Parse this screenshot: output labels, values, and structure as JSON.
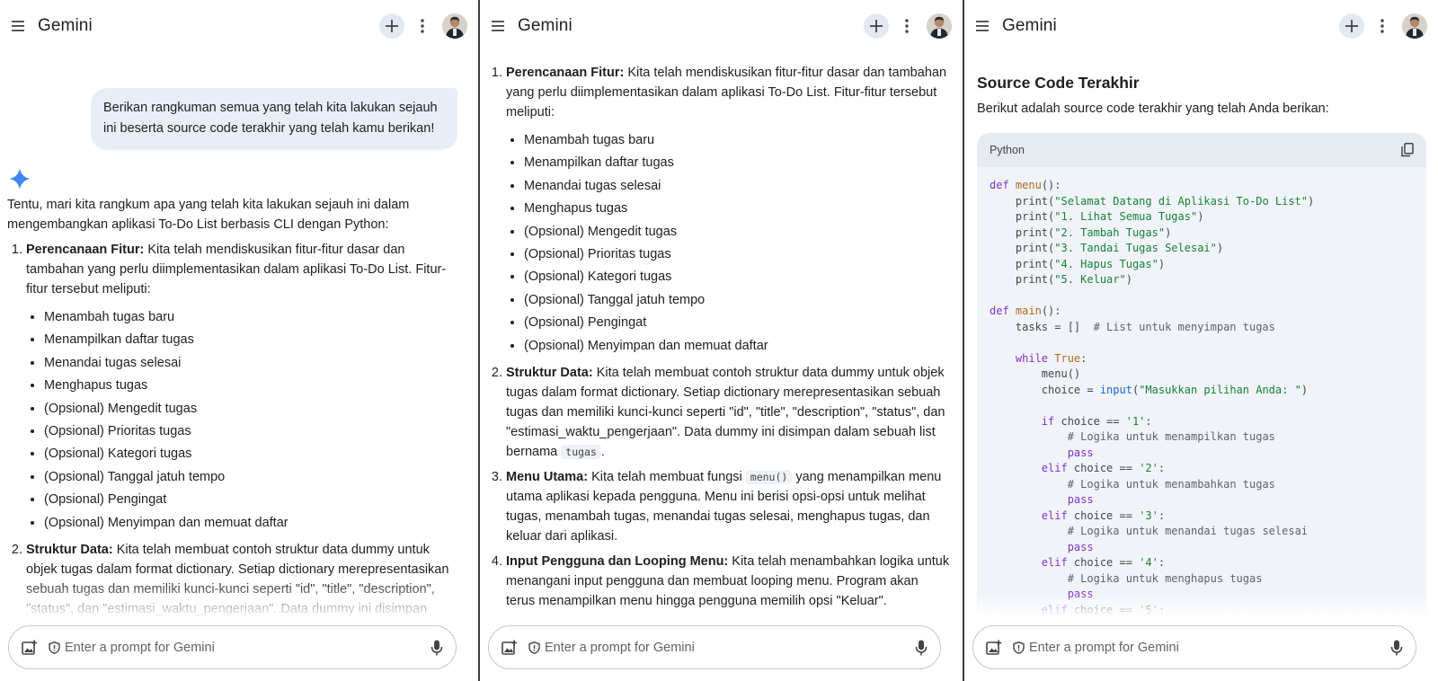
{
  "app": {
    "title": "Gemini",
    "prompt_placeholder": "Enter a prompt for Gemini"
  },
  "user_message": "Berikan rangkuman semua yang telah kita lakukan sejauh ini beserta source code terakhir yang telah kamu berikan!",
  "response": {
    "intro": "Tentu, mari kita rangkum apa yang telah kita lakukan sejauh ini dalam mengembangkan aplikasi To-Do List berbasis CLI dengan Python:",
    "items": [
      {
        "title": "Perencanaan Fitur:",
        "text": " Kita telah mendiskusikan fitur-fitur dasar dan tambahan yang perlu diimplementasikan dalam aplikasi To-Do List. Fitur-fitur tersebut meliputi:",
        "features": [
          "Menambah tugas baru",
          "Menampilkan daftar tugas",
          "Menandai tugas selesai",
          "Menghapus tugas",
          "(Opsional) Mengedit tugas",
          "(Opsional) Prioritas tugas",
          "(Opsional) Kategori tugas",
          "(Opsional) Tanggal jatuh tempo",
          "(Opsional) Pengingat",
          "(Opsional) Menyimpan dan memuat daftar"
        ]
      },
      {
        "title": "Struktur Data:",
        "text": " Kita telah membuat contoh struktur data dummy untuk objek tugas dalam format dictionary. Setiap dictionary merepresentasikan sebuah tugas dan memiliki kunci-kunci seperti \"id\", \"title\", \"description\", \"status\", dan \"estimasi_waktu_pengerjaan\". Data dummy ini disimpan dalam sebuah list bernama ",
        "code": "tugas",
        "text_after": "."
      },
      {
        "title": "Menu Utama:",
        "text": " Kita telah membuat fungsi ",
        "code": "menu()",
        "text_after": " yang menampilkan menu utama aplikasi kepada pengguna. Menu ini berisi opsi-opsi untuk melihat tugas, menambah tugas, menandai tugas selesai, menghapus tugas, dan keluar dari aplikasi."
      },
      {
        "title": "Input Pengguna dan Looping Menu:",
        "text": " Kita telah menambahkan logika untuk menangani input pengguna dan membuat looping menu. Program akan terus menampilkan menu hingga pengguna memilih opsi \"Keluar\"."
      }
    ]
  },
  "source_section": {
    "title": "Source Code Terakhir",
    "description": "Berikut adalah source code terakhir yang telah Anda berikan:",
    "language": "Python"
  },
  "colors": {
    "accent_blue": "#4285f4",
    "bubble_bg": "#e9eef6",
    "code_bg": "#f0f4f9",
    "keyword": "#8430ce",
    "string": "#188038"
  }
}
